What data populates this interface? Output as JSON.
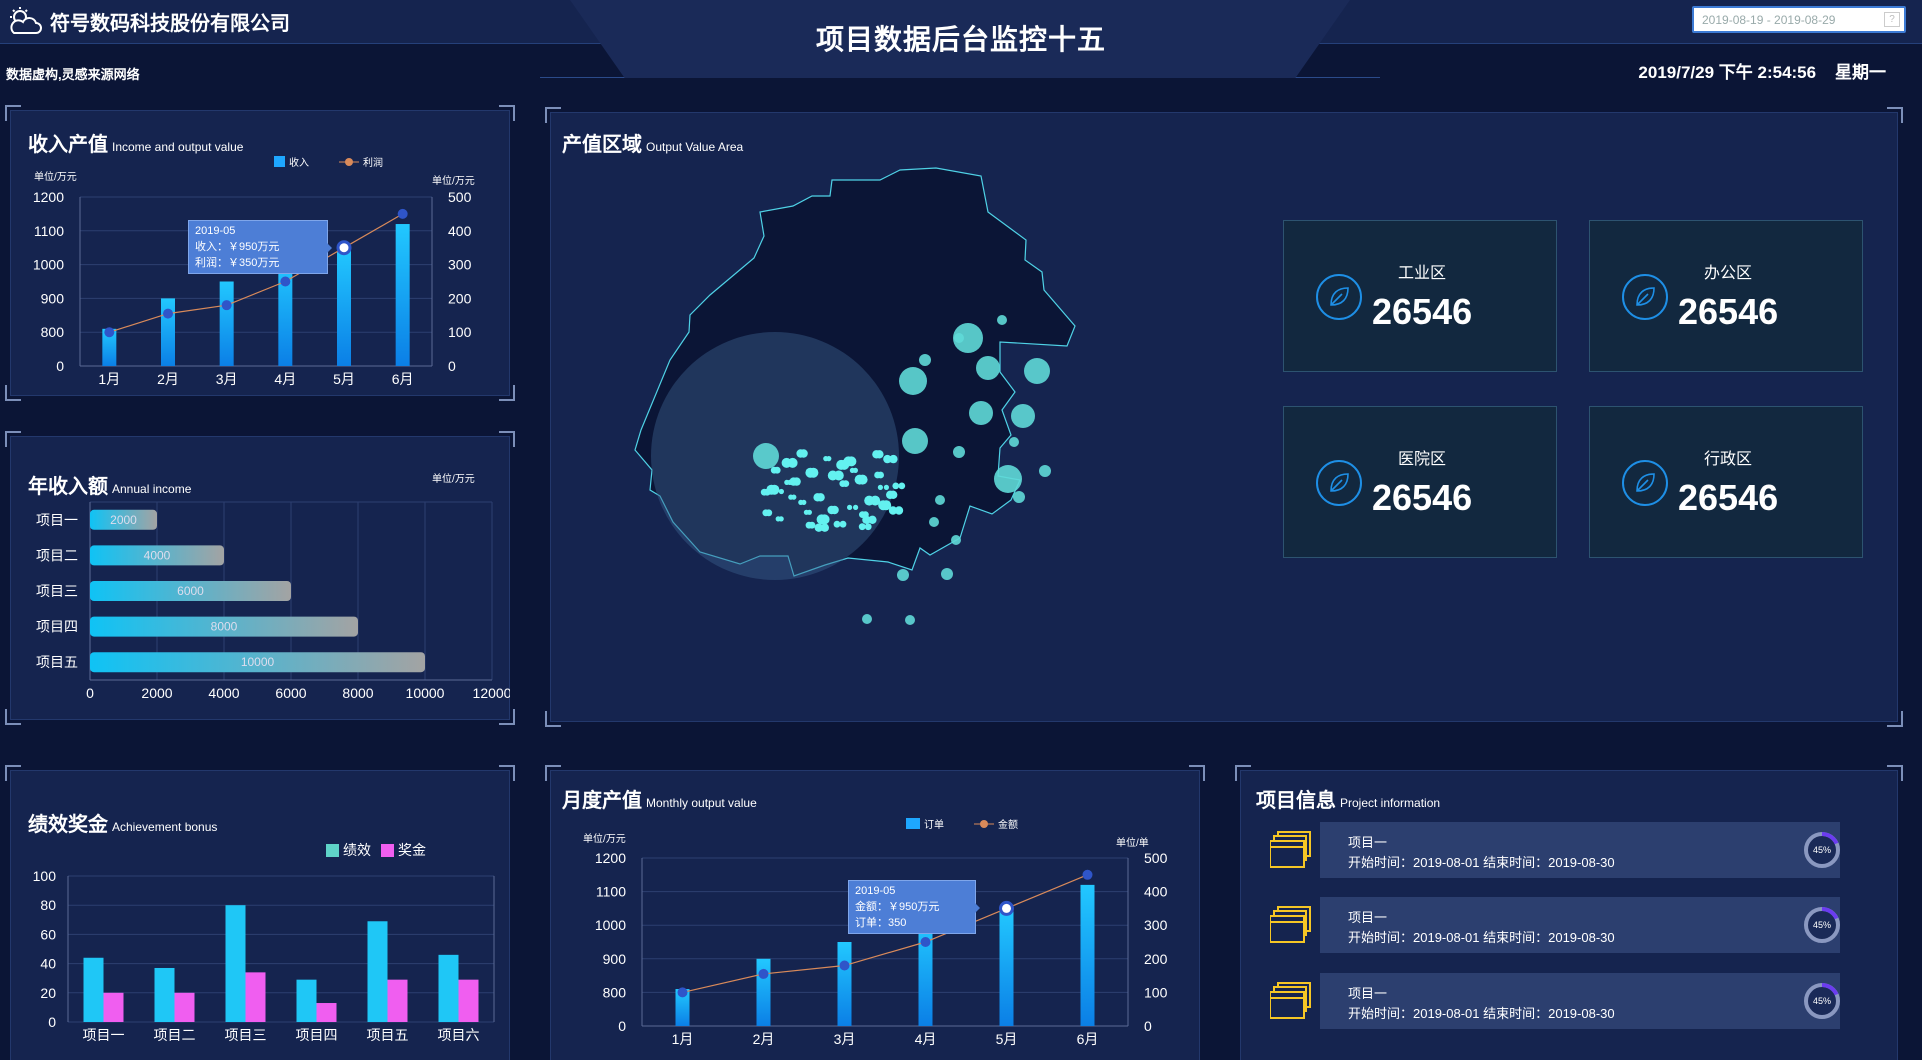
{
  "header": {
    "company": "符号数码科技股份有限公司",
    "note": "数据虚构,灵感来源网络",
    "title": "项目数据后台监控十五",
    "date_range": "2019-08-19 - 2019-08-29",
    "date_help": "?",
    "datetime": "2019/7/29 下午 2:54:56",
    "weekday": "星期一"
  },
  "income_panel": {
    "title": "收入产值",
    "subtitle": "Income and output value",
    "unit_left": "单位/万元",
    "unit_right": "单位/万元",
    "legend": [
      "收入",
      "利润"
    ],
    "tooltip": {
      "date": "2019-05",
      "line1": "收入：￥950万元",
      "line2": "利润：￥350万元"
    }
  },
  "annual_panel": {
    "title": "年收入额",
    "subtitle": "Annual income",
    "unit": "单位/万元"
  },
  "area_panel": {
    "title": "产值区域",
    "subtitle": "Output Value Area",
    "stats": [
      {
        "label": "工业区",
        "value": "26546"
      },
      {
        "label": "办公区",
        "value": "26546"
      },
      {
        "label": "医院区",
        "value": "26546"
      },
      {
        "label": "行政区",
        "value": "26546"
      }
    ]
  },
  "bonus_panel": {
    "title": "绩效奖金",
    "subtitle": "Achievement bonus",
    "legend": [
      "绩效",
      "奖金"
    ]
  },
  "monthly_panel": {
    "title": "月度产值",
    "subtitle": "Monthly output value",
    "unit_left": "单位/万元",
    "unit_right": "单位/单",
    "legend": [
      "订单",
      "金额"
    ],
    "tooltip": {
      "date": "2019-05",
      "line1": "金额：￥950万元",
      "line2": "订单：350"
    }
  },
  "project_panel": {
    "title": "项目信息",
    "subtitle": "Project information",
    "items": [
      {
        "name": "项目一",
        "time": "开始时间：2019-08-01 结束时间：2019-08-30",
        "pct": "45%"
      },
      {
        "name": "项目一",
        "time": "开始时间：2019-08-01 结束时间：2019-08-30",
        "pct": "45%"
      },
      {
        "name": "项目一",
        "time": "开始时间：2019-08-01 结束时间：2019-08-30",
        "pct": "45%"
      }
    ]
  },
  "chart_data": [
    {
      "type": "bar",
      "categories": [
        "1月",
        "2月",
        "3月",
        "4月",
        "5月",
        "6月"
      ],
      "series": [
        {
          "name": "收入",
          "type": "bar",
          "axis": "left",
          "values": [
            810,
            900,
            950,
            1010,
            1050,
            1120
          ]
        },
        {
          "name": "利润",
          "type": "line",
          "axis": "right",
          "values": [
            100,
            155,
            180,
            250,
            350,
            450
          ]
        }
      ],
      "ylim_left": [
        0,
        1200
      ],
      "yticks_left": [
        0,
        800,
        900,
        1000,
        1100,
        1200
      ],
      "ylim_right": [
        0,
        500
      ],
      "yticks_right": [
        0,
        100,
        200,
        300,
        400,
        500
      ],
      "colors": {
        "bar": "#1ea7ff",
        "line": "#d98a5a",
        "point": "#2f55c9"
      }
    },
    {
      "type": "bar",
      "orientation": "horizontal",
      "categories": [
        "项目一",
        "项目二",
        "项目三",
        "项目四",
        "项目五"
      ],
      "values": [
        2000,
        4000,
        6000,
        8000,
        10000
      ],
      "xlim": [
        0,
        12000
      ],
      "xticks": [
        0,
        2000,
        4000,
        6000,
        8000,
        10000,
        12000
      ],
      "colors": {
        "start": "#0fc3f5",
        "end": "#a3a3a3"
      }
    },
    {
      "type": "scatter",
      "description": "bubble map",
      "colors": {
        "point": "#5ff3f3",
        "region": "#0b1536",
        "outline": "#4fd2e6"
      }
    },
    {
      "type": "bar",
      "categories": [
        "项目一",
        "项目二",
        "项目三",
        "项目四",
        "项目五",
        "项目六"
      ],
      "series": [
        {
          "name": "绩效",
          "values": [
            44,
            37,
            80,
            29,
            69,
            46
          ]
        },
        {
          "name": "奖金",
          "values": [
            20,
            20,
            34,
            13,
            29,
            29
          ]
        }
      ],
      "ylim": [
        0,
        100
      ],
      "yticks": [
        0,
        20,
        40,
        60,
        80,
        100
      ],
      "colors": {
        "绩效": "#1fc7f6",
        "奖金": "#f05ef0"
      }
    },
    {
      "type": "bar",
      "categories": [
        "1月",
        "2月",
        "3月",
        "4月",
        "5月",
        "6月"
      ],
      "series": [
        {
          "name": "订单",
          "type": "bar",
          "axis": "left",
          "values": [
            810,
            900,
            950,
            1010,
            1050,
            1120
          ]
        },
        {
          "name": "金额",
          "type": "line",
          "axis": "right",
          "values": [
            100,
            155,
            180,
            250,
            350,
            450
          ]
        }
      ],
      "ylim_left": [
        0,
        1200
      ],
      "yticks_left": [
        0,
        800,
        900,
        1000,
        1100,
        1200
      ],
      "ylim_right": [
        0,
        500
      ],
      "yticks_right": [
        0,
        100,
        200,
        300,
        400,
        500
      ],
      "colors": {
        "bar": "#1ea7ff",
        "line": "#d98a5a",
        "point": "#2f55c9"
      }
    }
  ]
}
